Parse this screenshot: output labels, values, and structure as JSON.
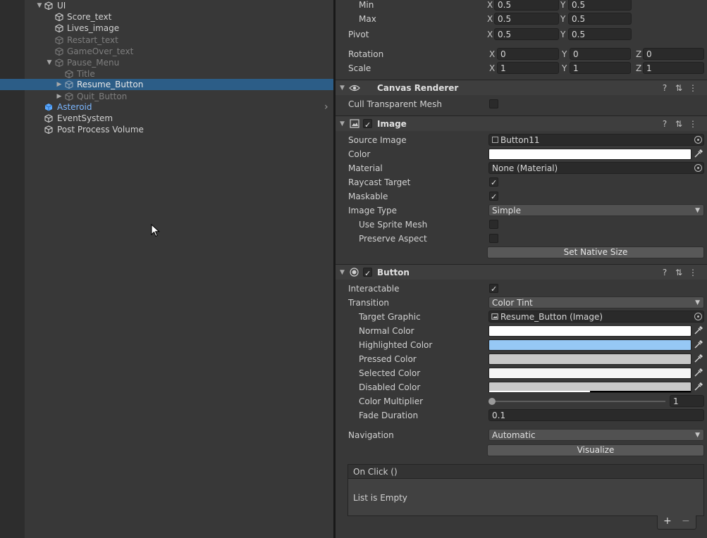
{
  "hierarchy": {
    "items": [
      {
        "label": "UI",
        "expanded": "▼",
        "state": "normal"
      },
      {
        "label": "Score_text",
        "state": "normal"
      },
      {
        "label": "Lives_image",
        "state": "normal"
      },
      {
        "label": "Restart_text",
        "state": "disabled"
      },
      {
        "label": "GameOver_text",
        "state": "disabled"
      },
      {
        "label": "Pause_Menu",
        "expanded": "▼",
        "state": "disabled"
      },
      {
        "label": "Title",
        "state": "disabled"
      },
      {
        "label": "Resume_Button",
        "expanded": "▶",
        "state": "selected"
      },
      {
        "label": "Quit_Button",
        "expanded": "▶",
        "state": "disabled"
      },
      {
        "label": "Asteroid",
        "state": "prefab",
        "chevron": "›"
      },
      {
        "label": "EventSystem",
        "state": "normal"
      },
      {
        "label": "Post Process Volume",
        "state": "normal"
      }
    ]
  },
  "rect_transform": {
    "min_label": "Min",
    "min_x": "0.5",
    "min_y": "0.5",
    "max_label": "Max",
    "max_x": "0.5",
    "max_y": "0.5",
    "pivot_label": "Pivot",
    "pivot_x": "0.5",
    "pivot_y": "0.5",
    "rotation_label": "Rotation",
    "rot_x": "0",
    "rot_y": "0",
    "rot_z": "0",
    "scale_label": "Scale",
    "scale_x": "1",
    "scale_y": "1",
    "scale_z": "1",
    "axis_x": "X",
    "axis_y": "Y",
    "axis_z": "Z"
  },
  "canvas_renderer": {
    "title": "Canvas Renderer",
    "cull_label": "Cull Transparent Mesh",
    "cull_checked": false
  },
  "image": {
    "title": "Image",
    "source_image_label": "Source Image",
    "source_image_value": "Button11",
    "color_label": "Color",
    "color_value": "#ffffff",
    "material_label": "Material",
    "material_value": "None (Material)",
    "raycast_label": "Raycast Target",
    "raycast_checked": true,
    "maskable_label": "Maskable",
    "maskable_checked": true,
    "image_type_label": "Image Type",
    "image_type_value": "Simple",
    "sprite_mesh_label": "Use Sprite Mesh",
    "preserve_label": "Preserve Aspect",
    "native_size_button": "Set Native Size"
  },
  "button": {
    "title": "Button",
    "interactable_label": "Interactable",
    "interactable_checked": true,
    "transition_label": "Transition",
    "transition_value": "Color Tint",
    "target_graphic_label": "Target Graphic",
    "target_graphic_value": "Resume_Button (Image)",
    "colors": [
      {
        "label": "Normal Color",
        "hex": "#ffffff"
      },
      {
        "label": "Highlighted Color",
        "hex": "#96c8f5"
      },
      {
        "label": "Pressed Color",
        "hex": "#c8c8c8"
      },
      {
        "label": "Selected Color",
        "hex": "#f5f5f5"
      },
      {
        "label": "Disabled Color",
        "hex": "#c8c8c8"
      }
    ],
    "multiplier_label": "Color Multiplier",
    "multiplier_value": "1",
    "fade_label": "Fade Duration",
    "fade_value": "0.1",
    "navigation_label": "Navigation",
    "navigation_value": "Automatic",
    "visualize_button": "Visualize",
    "onclick_title": "On Click ()",
    "onclick_empty": "List is Empty",
    "add_symbol": "+",
    "remove_symbol": "−"
  },
  "icons": {
    "check": "✓",
    "help": "?",
    "presets": "⇅",
    "menu": "⋮"
  }
}
